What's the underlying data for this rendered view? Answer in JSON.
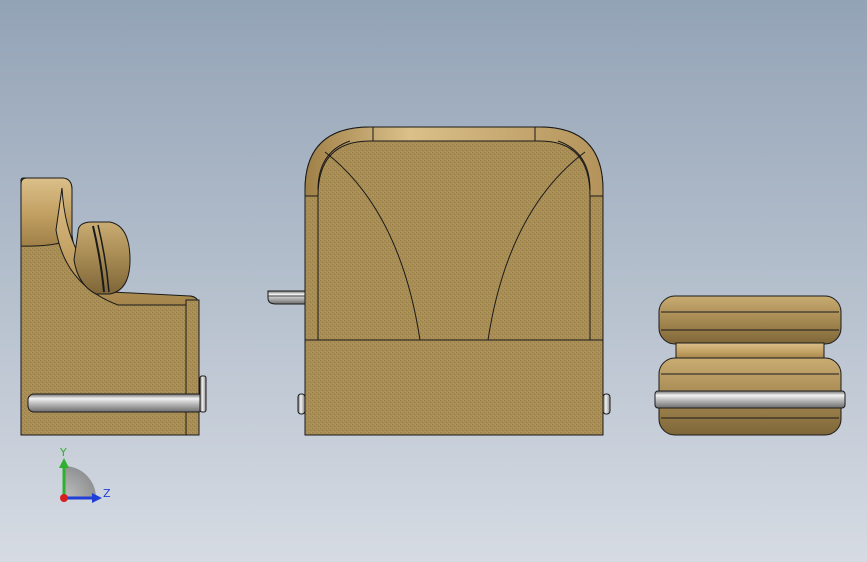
{
  "viewport": {
    "background_top": "#93a3b6",
    "background_bottom": "#d6dbe3"
  },
  "model": {
    "fabric_color": "#a88d55",
    "fabric_dark": "#8e7440",
    "wood_color": "#c4a265",
    "wood_light": "#dbc08a",
    "edge_color": "#1a1a1a",
    "chrome_light": "#f2f2f2",
    "chrome_mid": "#b9b9b9",
    "chrome_dark": "#6e6e6e"
  },
  "triad": {
    "y_label": "Y",
    "z_label": "Z",
    "y_color": "#2fb12f",
    "z_color": "#1f3fd6",
    "x_color": "#d62020",
    "arc_color": "#9a9a9a"
  }
}
